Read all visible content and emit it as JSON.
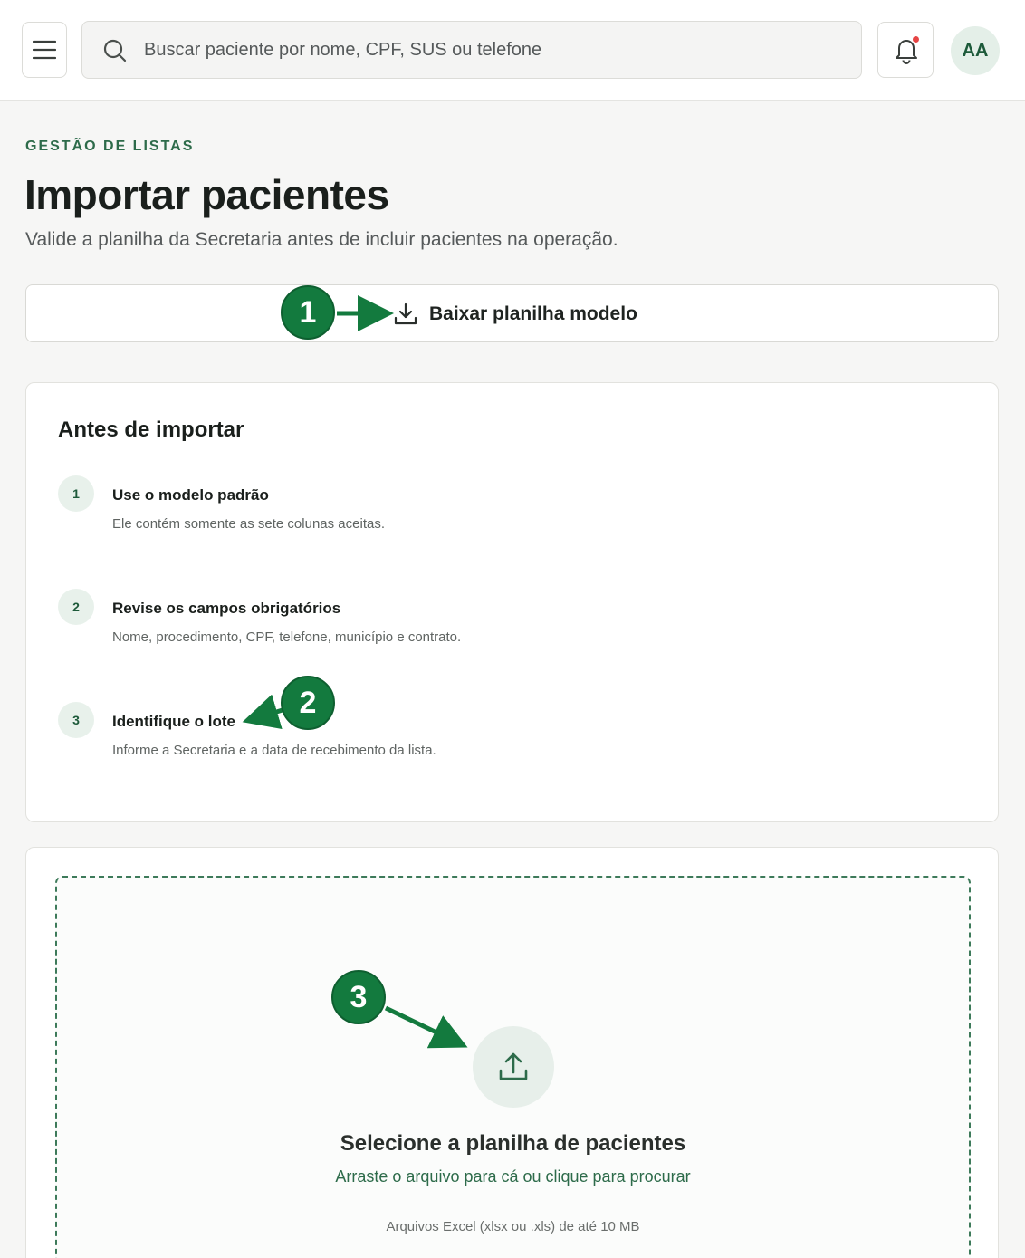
{
  "header": {
    "search_placeholder": "Buscar paciente por nome, CPF, SUS ou telefone",
    "avatar_initials": "AA"
  },
  "page": {
    "eyebrow": "GESTÃO DE LISTAS",
    "title": "Importar pacientes",
    "subtitle": "Valide a planilha da Secretaria antes de incluir pacientes na operação.",
    "download_label": "Baixar planilha modelo"
  },
  "before": {
    "title": "Antes de importar",
    "steps": [
      {
        "num": "1",
        "title": "Use o modelo padrão",
        "desc": "Ele contém somente as sete colunas aceitas."
      },
      {
        "num": "2",
        "title": "Revise os campos obrigatórios",
        "desc": "Nome, procedimento, CPF, telefone, município e contrato."
      },
      {
        "num": "3",
        "title": "Identifique o lote",
        "desc": "Informe a Secretaria e a data de recebimento da lista."
      }
    ]
  },
  "upload": {
    "title": "Selecione a planilha de pacientes",
    "link": "Arraste o arquivo para cá ou clique para procurar",
    "hint": "Arquivos Excel (xlsx ou .xls) de até 10 MB"
  },
  "annotations": [
    "1",
    "2",
    "3"
  ],
  "colors": {
    "brand_green": "#2d6b4a",
    "annotation_green": "#137a3e",
    "notification_dot": "#e64444"
  }
}
